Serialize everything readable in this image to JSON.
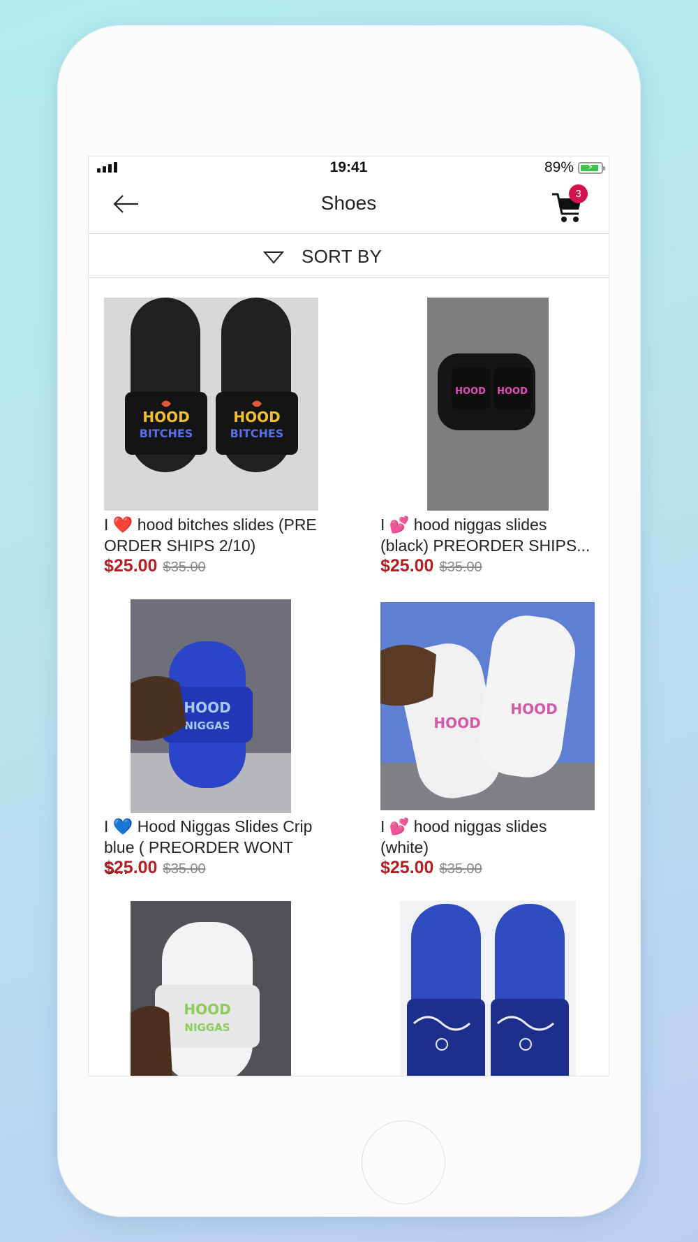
{
  "status_bar": {
    "time": "19:41",
    "battery_percent": "89%",
    "battery_level": 0.89
  },
  "nav": {
    "title": "Shoes",
    "cart_count": "3"
  },
  "sort": {
    "label": "SORT BY"
  },
  "colors": {
    "price": "#b21f25",
    "badge": "#d3114f",
    "battery": "#3ac24b"
  },
  "products": [
    {
      "name": "I ❤️ hood bitches slides (PRE ORDER SHIPS 2/10)",
      "price": "$25.00",
      "old_price": "$35.00"
    },
    {
      "name": "I 💕 hood niggas slides (black) PREORDER SHIPS...",
      "price": "$25.00",
      "old_price": "$35.00"
    },
    {
      "name": "I 💙 Hood Niggas Slides Crip blue ( PREORDER WONT S...",
      "price": "$25.00",
      "old_price": "$35.00"
    },
    {
      "name": "I 💕 hood niggas slides (white)",
      "price": "$25.00",
      "old_price": "$35.00"
    },
    {
      "name": "",
      "price": "",
      "old_price": ""
    },
    {
      "name": "",
      "price": "",
      "old_price": ""
    }
  ]
}
